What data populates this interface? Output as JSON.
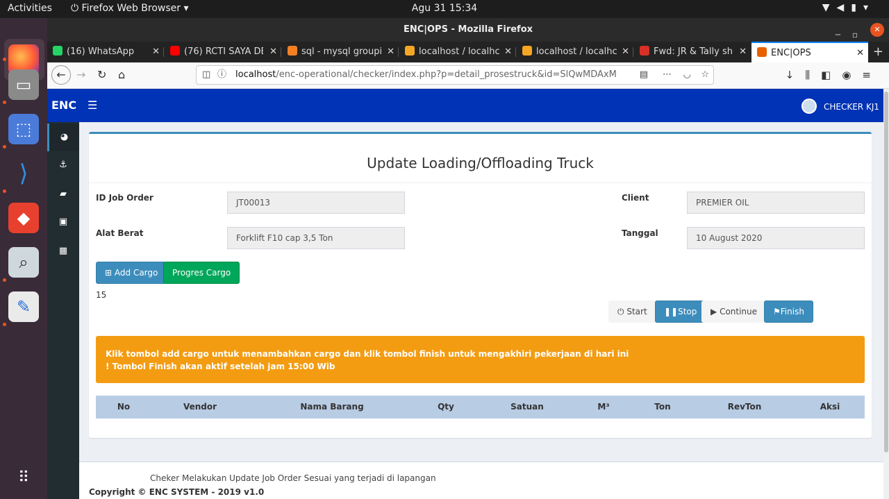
{
  "os": {
    "activities": "Activities",
    "app_menu": "Firefox Web Browser ▾",
    "clock": "Agu 31  15:34"
  },
  "browser": {
    "window_title": "ENC|OPS - Mozilla Firefox",
    "tabs": [
      {
        "label": "(16) WhatsApp",
        "icon_color": "#25d366",
        "icon": "whatsapp-icon"
      },
      {
        "label": "(76) RCTI SAYA DE",
        "icon_color": "#ff0000",
        "icon": "youtube-icon"
      },
      {
        "label": "sql - mysql groupi",
        "icon_color": "#f48024",
        "icon": "stackoverflow-icon"
      },
      {
        "label": "localhost / localhc",
        "icon_color": "#f5a623",
        "icon": "phpmyadmin-icon"
      },
      {
        "label": "localhost / localhc",
        "icon_color": "#f5a623",
        "icon": "phpmyadmin-icon"
      },
      {
        "label": "Fwd: JR & Tally sh",
        "icon_color": "#d93025",
        "icon": "gmail-icon"
      },
      {
        "label": "ENC|OPS",
        "icon_color": "#e66000",
        "icon": "page-icon"
      }
    ],
    "url_host": "localhost",
    "url_path": "/enc-operational/checker/index.php?p=detail_prosestruck&id=SlQwMDAxM"
  },
  "app": {
    "brand": "ENC",
    "user_name": "CHECKER KJ1",
    "sidebar": [
      "dashboard-icon",
      "anchor-icon",
      "truck-icon",
      "briefcase-icon",
      "train-icon"
    ],
    "page_title": "Update Loading/Offloading Truck",
    "fields": {
      "id_job_order_label": "ID Job Order",
      "id_job_order_value": "JT00013",
      "alat_berat_label": "Alat Berat",
      "alat_berat_value": "Forklift F10 cap 3,5 Ton",
      "client_label": "Client",
      "client_value": "PREMIER OIL",
      "tanggal_label": "Tanggal",
      "tanggal_value": "10 August 2020"
    },
    "buttons": {
      "add_cargo": "Add Cargo",
      "progres_cargo": "Progres Cargo",
      "start": "Start",
      "stop": "Stop",
      "continue": "Continue",
      "finish": "Finish"
    },
    "count": "15",
    "alert_line1": "Klik tombol add cargo untuk menambahkan cargo dan klik tombol finish untuk mengakhiri pekerjaan di hari ini",
    "alert_line2": "! Tombol Finish akan aktif setelah jam 15:00 Wib",
    "table_headers": [
      "No",
      "Vendor",
      "Nama Barang",
      "Qty",
      "Satuan",
      "M³",
      "Ton",
      "RevTon",
      "Aksi"
    ],
    "footer_note": "Cheker Melakukan Update Job Order Sesuai yang terjadi di lapangan",
    "footer_copy": "Copyright © ENC SYSTEM - 2019 v1.0"
  }
}
